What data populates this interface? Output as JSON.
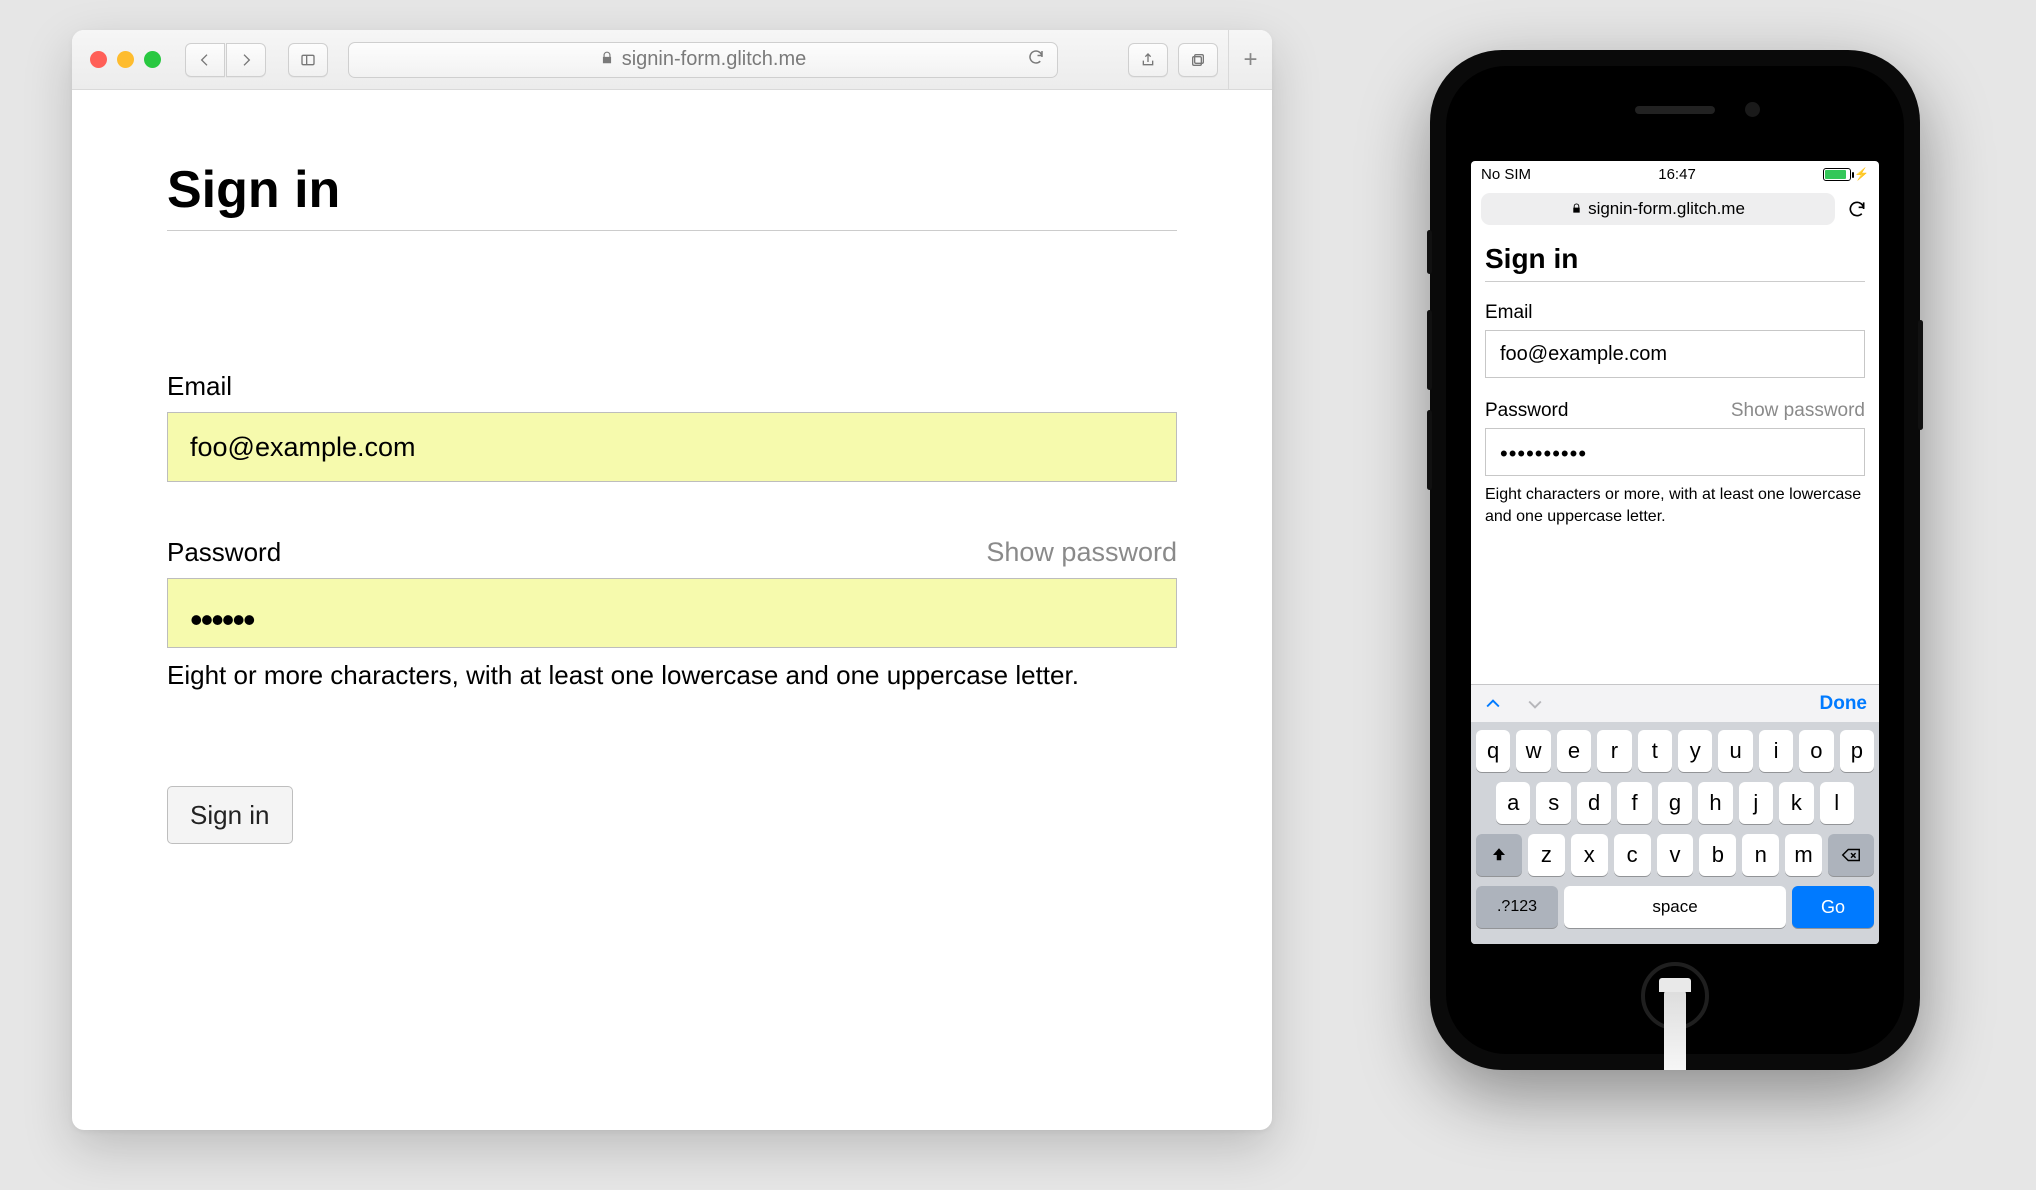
{
  "desktop": {
    "url_host": "signin-form.glitch.me",
    "heading": "Sign in",
    "email_label": "Email",
    "email_value": "foo@example.com",
    "password_label": "Password",
    "show_password": "Show password",
    "password_masked": "••••••",
    "password_hint": "Eight or more characters, with at least one lowercase and one uppercase letter.",
    "submit_label": "Sign in"
  },
  "mobile": {
    "status": {
      "carrier": "No SIM",
      "time": "16:47"
    },
    "url_host": "signin-form.glitch.me",
    "heading": "Sign in",
    "email_label": "Email",
    "email_value": "foo@example.com",
    "password_label": "Password",
    "show_password": "Show password",
    "password_masked": "••••••••••",
    "password_hint": "Eight characters or more, with at least one lowercase and one uppercase letter.",
    "keyboard": {
      "accessory_done": "Done",
      "row1": [
        "q",
        "w",
        "e",
        "r",
        "t",
        "y",
        "u",
        "i",
        "o",
        "p"
      ],
      "row2": [
        "a",
        "s",
        "d",
        "f",
        "g",
        "h",
        "j",
        "k",
        "l"
      ],
      "row3": [
        "z",
        "x",
        "c",
        "v",
        "b",
        "n",
        "m"
      ],
      "numeric": ".?123",
      "space": "space",
      "go": "Go"
    }
  }
}
